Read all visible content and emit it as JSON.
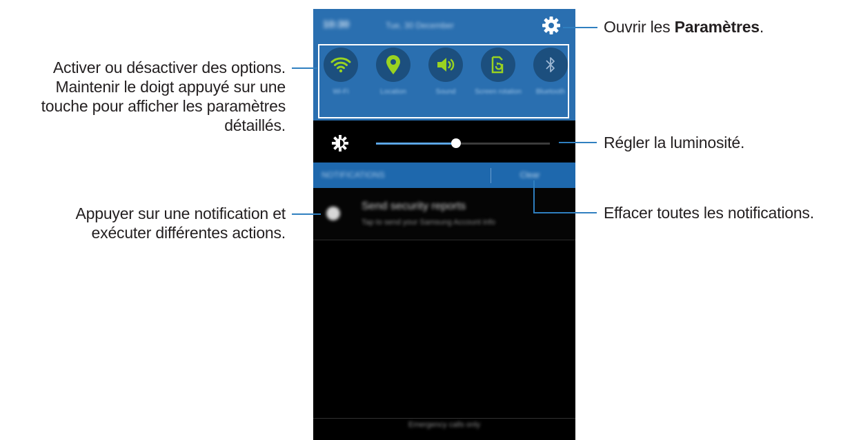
{
  "status_bar": {
    "date": "10:30",
    "day": "Tue, 30 December"
  },
  "quick_settings": [
    {
      "icon": "wifi-icon",
      "label": "Wi-Fi"
    },
    {
      "icon": "location-icon",
      "label": "Location"
    },
    {
      "icon": "sound-icon",
      "label": "Sound"
    },
    {
      "icon": "screen-rotation-icon",
      "label": "Screen rotation"
    },
    {
      "icon": "bluetooth-icon",
      "label": "Bluetooth"
    }
  ],
  "brightness": {
    "level_percent": 46
  },
  "notifications": {
    "header_title": "NOTIFICATIONS",
    "clear_label": "Clear",
    "items": [
      {
        "title": "Send security reports",
        "text": "Tap to send your Samsung Account info"
      }
    ]
  },
  "footer": {
    "emergency_label": "Emergency calls only"
  },
  "annotations": {
    "settings_prefix": "Ouvrir les ",
    "settings_bold": "Paramètres",
    "settings_suffix": ".",
    "options_line1": "Activer ou désactiver des options.",
    "options_line2": "Maintenir le doigt appuyé sur une",
    "options_line3": "touche pour afficher les paramètres",
    "options_line4": "détaillés.",
    "brightness": "Régler la luminosité.",
    "clear": "Effacer toutes les notifications.",
    "notif_line1": "Appuyer sur une notification et",
    "notif_line2": "exécuter différentes actions."
  },
  "colors": {
    "panel_blue": "#2a6fb0",
    "header_blue": "#1e68ad",
    "icon_green": "#9ad321",
    "leader_blue": "#2f7fc0"
  }
}
